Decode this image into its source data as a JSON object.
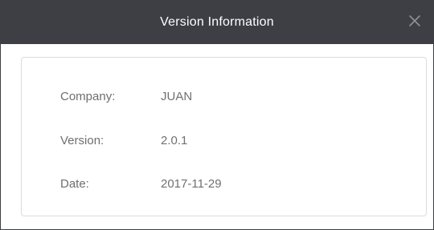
{
  "window": {
    "title": "Version Information",
    "close_icon": "close-icon",
    "titlebar_color": "#3d3f45"
  },
  "info": {
    "company": {
      "label": "Company:",
      "value": "JUAN"
    },
    "version": {
      "label": "Version:",
      "value": "2.0.1"
    },
    "date": {
      "label": "Date:",
      "value": "2017-11-29"
    }
  }
}
